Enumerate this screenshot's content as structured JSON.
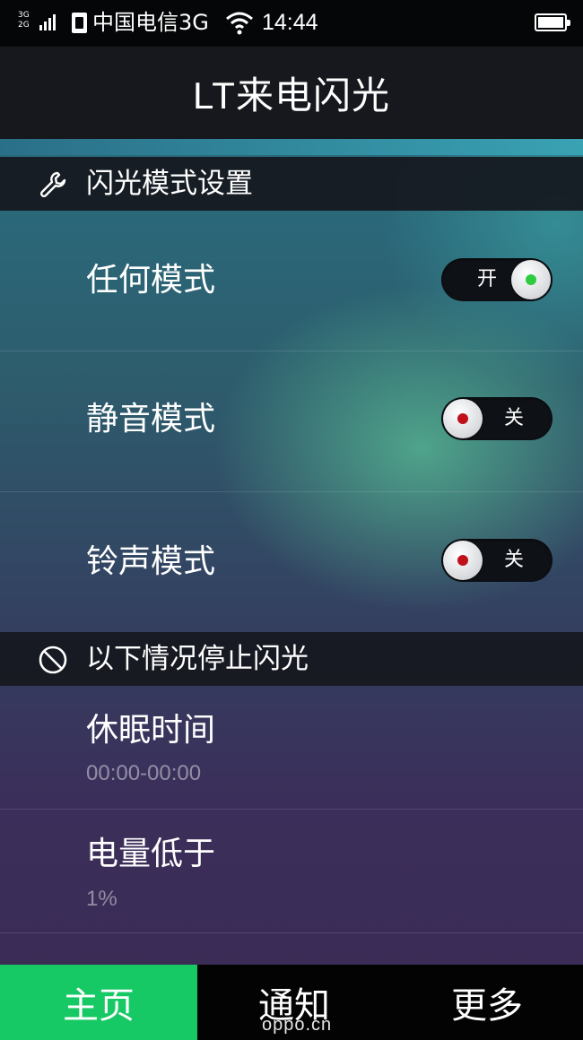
{
  "status_bar": {
    "network_top": "3G",
    "network_bottom": "2G",
    "carrier": "中国电信3G",
    "time": "14:44"
  },
  "header": {
    "title": "LT来电闪光"
  },
  "section_flash_mode": {
    "title": "闪光模式设置",
    "icon": "wrench-icon",
    "rows": [
      {
        "label": "任何模式",
        "toggle_state": "开",
        "on": true
      },
      {
        "label": "静音模式",
        "toggle_state": "关",
        "on": false
      },
      {
        "label": "铃声模式",
        "toggle_state": "关",
        "on": false
      }
    ]
  },
  "section_stop_flash": {
    "title": "以下情况停止闪光",
    "icon": "no-entry-icon",
    "rows": [
      {
        "label": "休眠时间",
        "value": "00:00-00:00"
      },
      {
        "label": "电量低于",
        "value": "1%"
      }
    ]
  },
  "tabs": [
    {
      "label": "主页",
      "active": true
    },
    {
      "label": "通知",
      "active": false
    },
    {
      "label": "更多",
      "active": false
    }
  ],
  "watermark": "oppo.cn",
  "colors": {
    "accent_green": "#17c964",
    "toggle_on_dot": "#2ecc40",
    "toggle_off_dot": "#c0111a",
    "header_bg": "#16181d"
  }
}
